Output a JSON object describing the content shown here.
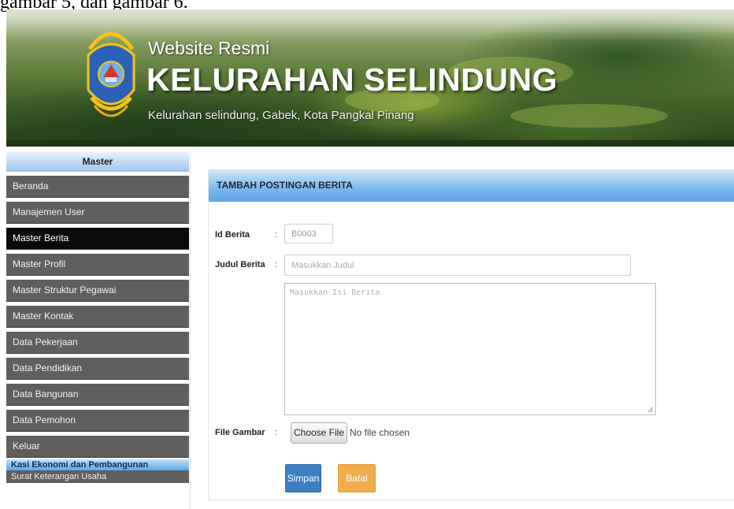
{
  "caption": "gambar 5, dan gambar 6.",
  "header": {
    "subtitle": "Website Resmi",
    "title": "KELURAHAN SELINDUNG",
    "address": "Kelurahan selindung, Gabek, Kota Pangkal Pinang"
  },
  "sidebar": {
    "heading": "Master",
    "items": [
      {
        "label": "Beranda"
      },
      {
        "label": "Manajemen User"
      },
      {
        "label": "Master Berita"
      },
      {
        "label": "Master Profil"
      },
      {
        "label": "Master Struktur Pegawai"
      },
      {
        "label": "Master Kontak"
      },
      {
        "label": "Data Pekerjaan"
      },
      {
        "label": "Data Pendidikan"
      },
      {
        "label": "Data Bangunan"
      },
      {
        "label": "Data Pemohon"
      },
      {
        "label": "Keluar"
      }
    ],
    "active_index": 2,
    "sub_heading": "Kasi Ekonomi dan Pembangunan",
    "sub_item": "Surat Keterangan Usaha"
  },
  "form": {
    "heading": "TAMBAH POSTINGAN BERITA",
    "id_label": "Id Berita",
    "id_value": "B0003",
    "title_label": "Judul Berita",
    "title_placeholder": "Masukkan Judul",
    "content_placeholder": "Masukkan Isi Berita",
    "file_label": "File Gambar",
    "file_button": "Choose File",
    "file_status": "No file chosen",
    "colon": ":",
    "save_label": "Simpan",
    "cancel_label": "Batal"
  },
  "colors": {
    "accent_blue": "#5aa3e6",
    "sidebar_item": "#5f5f5f",
    "sidebar_active": "#0a0a0a",
    "save_button": "#3d7fc4",
    "cancel_button": "#f0ad4e"
  }
}
